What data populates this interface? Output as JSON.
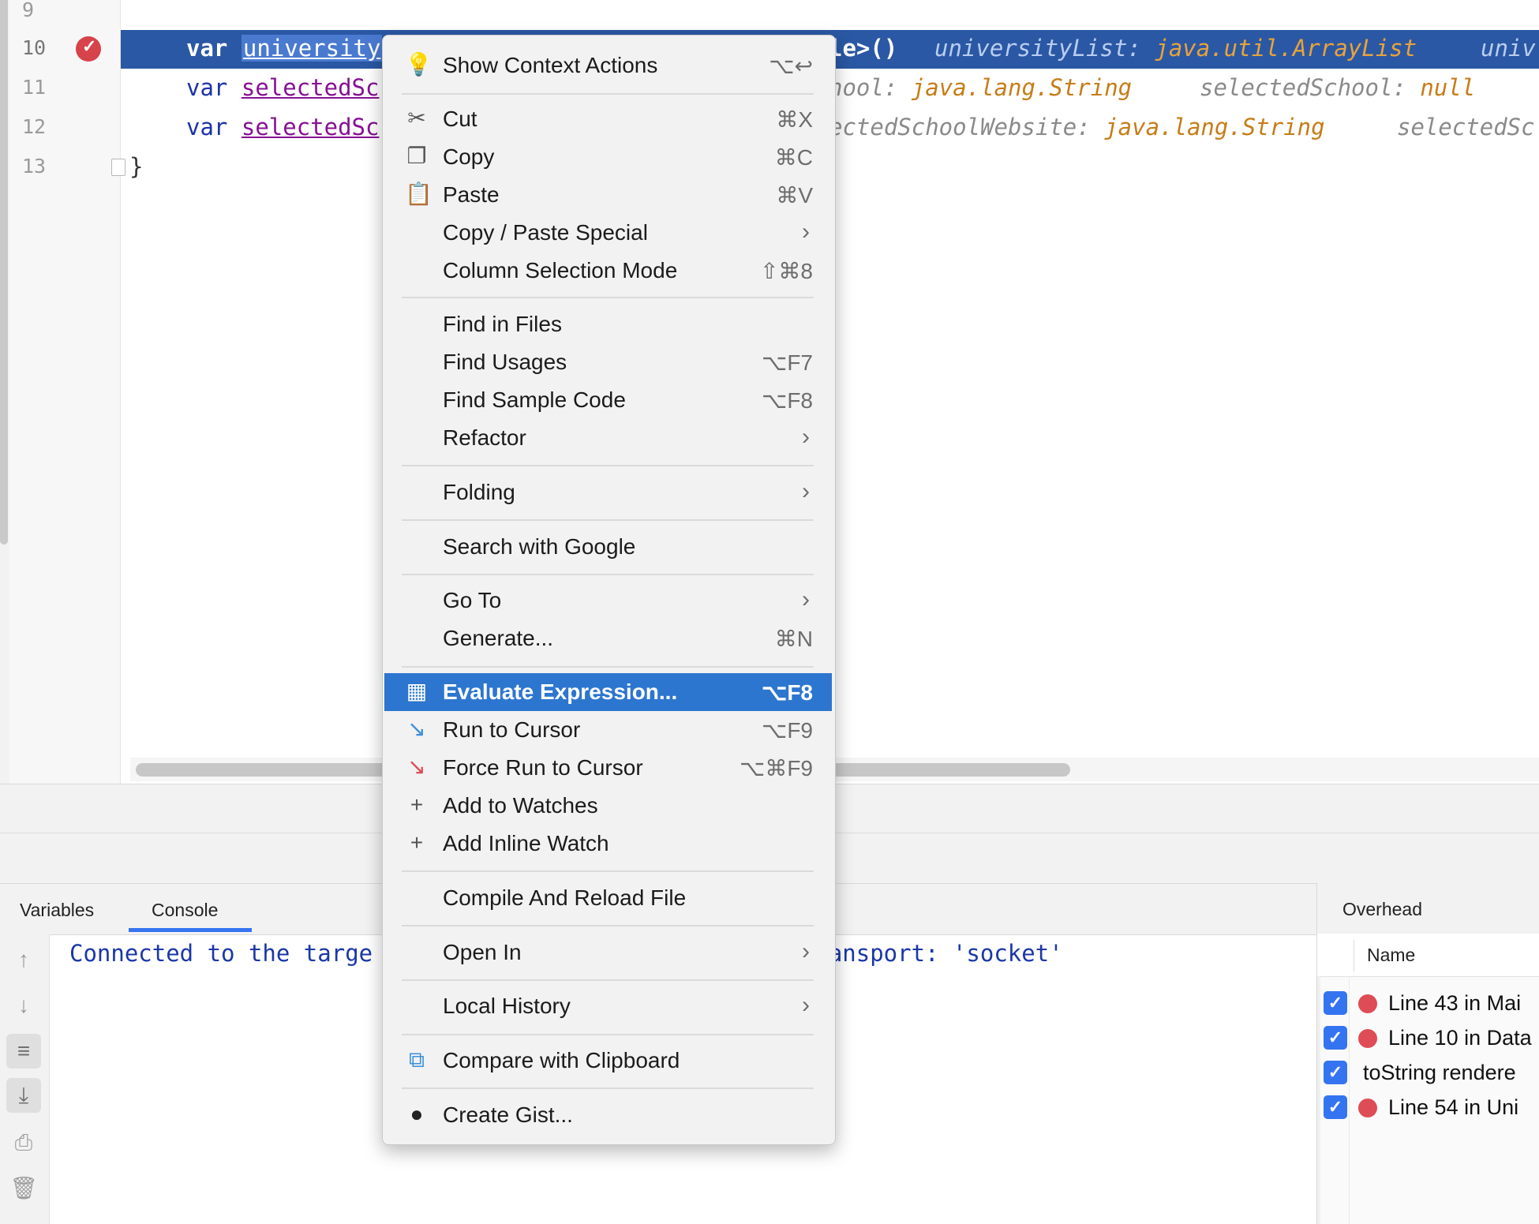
{
  "editor": {
    "line_numbers": [
      "9",
      "10",
      "11",
      "12",
      "13"
    ],
    "lines": [
      {
        "keyword": "var",
        "selected_var": "university",
        "after": "le>()"
      },
      {
        "keyword": "var",
        "var": "selectedSc"
      },
      {
        "keyword": "var",
        "var": "selectedSc"
      },
      {
        "brace": "}"
      }
    ],
    "hints": {
      "line10_a_name": "universityList:",
      "line10_a_type": "java.util.ArrayList",
      "line10_b": "univ",
      "line11_a_name": "hool:",
      "line11_a_type": "java.lang.String",
      "line11_b_name": "selectedSchool:",
      "line11_b_type": "null",
      "line12_a_name": "ectedSchoolWebsite:",
      "line12_a_type": "java.lang.String",
      "line12_b": "selectedSc"
    }
  },
  "context_menu": {
    "items": [
      {
        "label": "Show Context Actions",
        "shortcut": "⌥↩",
        "icon": "lightbulb-icon"
      },
      {
        "label": "Cut",
        "shortcut": "⌘X",
        "icon": "scissors-icon"
      },
      {
        "label": "Copy",
        "shortcut": "⌘C",
        "icon": "copy-icon"
      },
      {
        "label": "Paste",
        "shortcut": "⌘V",
        "icon": "clipboard-icon"
      },
      {
        "label": "Copy / Paste Special",
        "submenu": true
      },
      {
        "label": "Column Selection Mode",
        "shortcut": "⇧⌘8"
      },
      {
        "label": "Find in Files"
      },
      {
        "label": "Find Usages",
        "shortcut": "⌥F7"
      },
      {
        "label": "Find Sample Code",
        "shortcut": "⌥F8"
      },
      {
        "label": "Refactor",
        "submenu": true
      },
      {
        "label": "Folding",
        "submenu": true
      },
      {
        "label": "Search with Google"
      },
      {
        "label": "Go To",
        "submenu": true
      },
      {
        "label": "Generate...",
        "shortcut": "⌘N"
      },
      {
        "label": "Evaluate Expression...",
        "shortcut": "⌥F8",
        "icon": "calculator-icon",
        "selected": true
      },
      {
        "label": "Run to Cursor",
        "shortcut": "⌥F9",
        "icon": "run-to-cursor-icon"
      },
      {
        "label": "Force Run to Cursor",
        "shortcut": "⌥⌘F9",
        "icon": "force-run-to-cursor-icon"
      },
      {
        "label": "Add to Watches",
        "icon": "add-watch-icon"
      },
      {
        "label": "Add Inline Watch",
        "icon": "add-inline-watch-icon"
      },
      {
        "label": "Compile And Reload File"
      },
      {
        "label": "Open In",
        "submenu": true
      },
      {
        "label": "Local History",
        "submenu": true
      },
      {
        "label": "Compare with Clipboard",
        "icon": "compare-clipboard-icon"
      },
      {
        "label": "Create Gist...",
        "icon": "github-icon"
      }
    ]
  },
  "debug": {
    "tabs": [
      "Variables",
      "Console"
    ],
    "active_tab": "Console",
    "console_line_left": "Connected to the targe",
    "console_line_right": ", transport: 'socket'",
    "overhead_title": "Overhead",
    "column_name": "Name",
    "rows": [
      {
        "text": "Line 43 in Mai",
        "checked": true,
        "dot": true
      },
      {
        "text": "Line 10 in Data",
        "checked": true,
        "dot": true
      },
      {
        "text": "toString rendere",
        "checked": true,
        "dot": false
      },
      {
        "text": "Line 54 in Uni",
        "checked": true,
        "dot": true
      }
    ]
  },
  "colors": {
    "accent": "#3574f0",
    "menu_selection": "#2c76cf",
    "current_line": "#2b58a4",
    "breakpoint": "#d7434b"
  }
}
